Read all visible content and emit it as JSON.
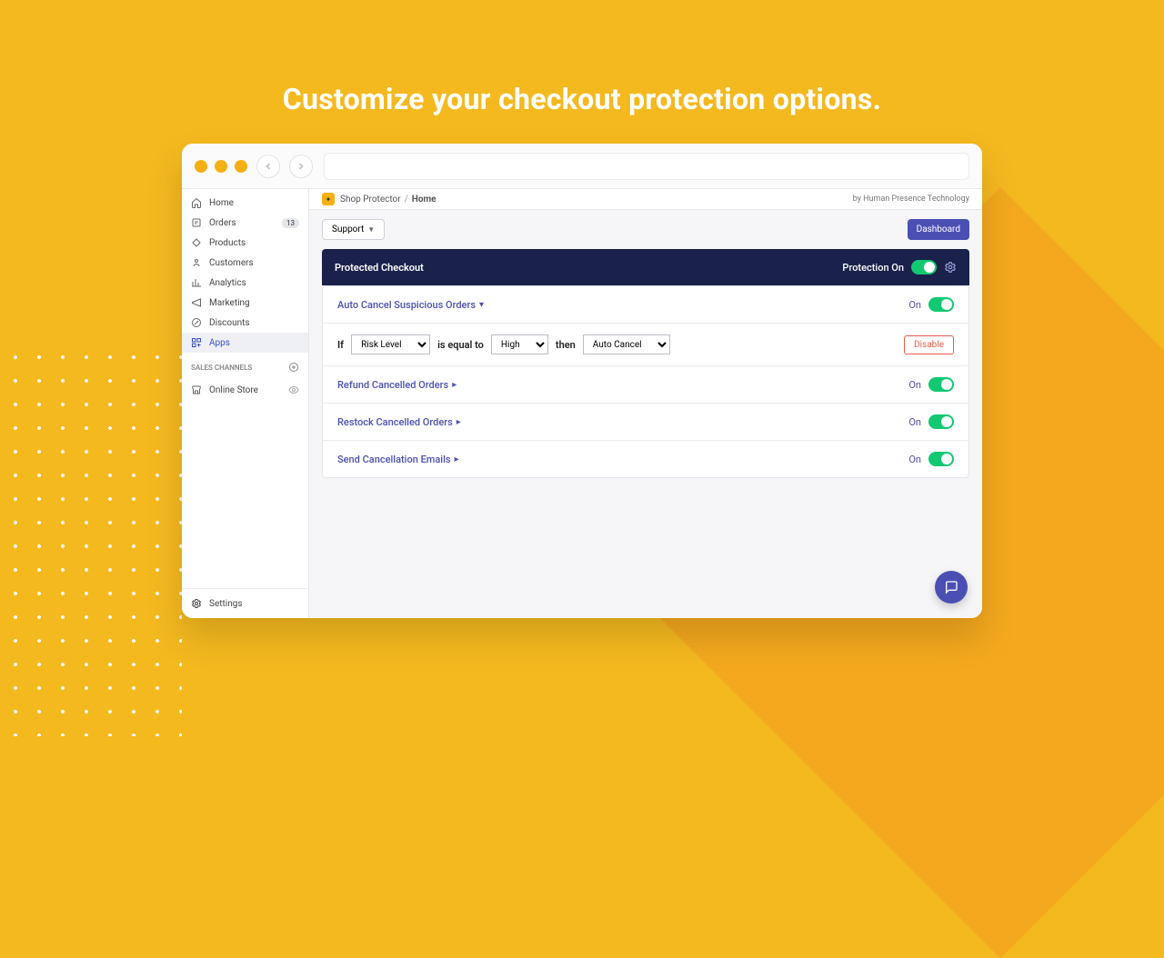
{
  "headline": "Customize your checkout protection options.",
  "sidebar": {
    "items": [
      {
        "label": "Home",
        "icon": "home-icon"
      },
      {
        "label": "Orders",
        "icon": "orders-icon",
        "badge": "13"
      },
      {
        "label": "Products",
        "icon": "products-icon"
      },
      {
        "label": "Customers",
        "icon": "customers-icon"
      },
      {
        "label": "Analytics",
        "icon": "analytics-icon"
      },
      {
        "label": "Marketing",
        "icon": "marketing-icon"
      },
      {
        "label": "Discounts",
        "icon": "discounts-icon"
      },
      {
        "label": "Apps",
        "icon": "apps-icon",
        "active": true
      }
    ],
    "channels_label": "SALES CHANNELS",
    "channels": [
      {
        "label": "Online Store",
        "icon": "store-icon"
      }
    ],
    "settings_label": "Settings"
  },
  "crumb": {
    "app_name": "Shop Protector",
    "page": "Home",
    "by_line": "by Human Presence Technology"
  },
  "toolbar": {
    "support_label": "Support",
    "dashboard_label": "Dashboard"
  },
  "panel": {
    "header_title": "Protected Checkout",
    "header_status_label": "Protection On",
    "options": [
      {
        "title": "Auto Cancel Suspicious Orders",
        "status_label": "On",
        "expanded": true
      },
      {
        "title": "Refund Cancelled Orders",
        "status_label": "On",
        "expanded": false
      },
      {
        "title": "Restock Cancelled Orders",
        "status_label": "On",
        "expanded": false
      },
      {
        "title": "Send Cancellation Emails",
        "status_label": "On",
        "expanded": false
      }
    ],
    "rule": {
      "if_label": "If",
      "field_options": [
        "Risk Level"
      ],
      "field_value": "Risk Level",
      "operator_label": "is equal to",
      "value_options": [
        "High"
      ],
      "value_value": "High",
      "then_label": "then",
      "action_options": [
        "Auto Cancel"
      ],
      "action_value": "Auto Cancel",
      "disable_label": "Disable"
    }
  }
}
